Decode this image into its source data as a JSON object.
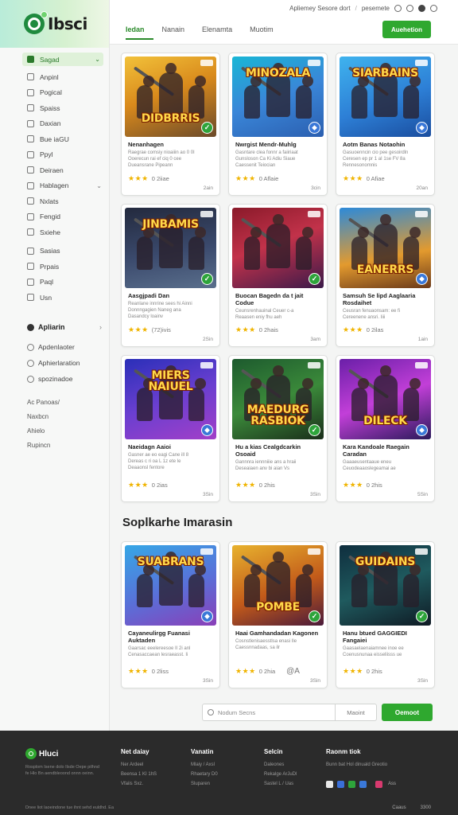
{
  "app": {
    "logo_text": "Ibsci"
  },
  "topbar": {
    "util_text": "Apliemey Sesore dort",
    "util_sep": "/",
    "util_link": "pesemete",
    "tabs": [
      "Iedan",
      "Nanain",
      "Elenamta",
      "Muotim"
    ],
    "cta": "Auehetion"
  },
  "sidebar": {
    "items": [
      {
        "label": "Sagad",
        "active": true
      },
      {
        "label": "Anpinl"
      },
      {
        "label": "Pogical"
      },
      {
        "label": "Spaiss"
      },
      {
        "label": "Daxian"
      },
      {
        "label": "Bue iaGU"
      },
      {
        "label": "Ppyl"
      },
      {
        "label": "Deiraen"
      },
      {
        "label": "Hablagen",
        "chevron": true
      },
      {
        "label": "Nxlats"
      },
      {
        "label": "Fengid"
      },
      {
        "label": "Sxiehe"
      },
      {
        "label": "Sasias"
      },
      {
        "label": "Prpais"
      },
      {
        "label": "Paql"
      },
      {
        "label": "Usn"
      }
    ],
    "section2_title": "Apliarin",
    "section2_items": [
      "Apdenlaoter",
      "Aphierlaration",
      "spozinadoe"
    ],
    "plain_items": [
      "Ac Panoas/",
      "Naxbcn",
      "Ahielo",
      "Rupincn"
    ]
  },
  "cards": [
    {
      "title": "Nenanhagen",
      "desc1": "Raegrae comsiy nioaiiin ao 0 0I",
      "desc2": "Ooerecun rai ef ciq 0 cee",
      "desc3": "Dueansrane Pipeann",
      "reviews": "0 2iiae",
      "size": "2ain",
      "thumb_text": "DIDBRRIS",
      "bg": "linear-gradient(160deg,#f2c23a 0%,#d98a1c 45%,#6b4a2a 100%)",
      "badge": "green",
      "badge_icon": "✓"
    },
    {
      "title": "Nwrgist Mendr-Muhlg",
      "desc1": "Gasntare clea fonnr a faiiriaat",
      "desc2": "Gunsloson Ca Ki Adiu Siaue",
      "desc3": "Caessenit Teiocian",
      "reviews": "0 Aflaie",
      "size": "3cin",
      "thumb_text": "MINOZALA",
      "thumb_top": true,
      "bg": "linear-gradient(160deg,#19b6d6 0%,#3a86d8 50%,#2b5fb0 100%)",
      "badge": "blue",
      "badge_icon": "⬥"
    },
    {
      "title": "Aotm Banas Notaohin",
      "desc1": "Gasuoenncin cio pee gesoirdln",
      "desc2": "Ceresen ep pr 1 aI 1se FV 8a",
      "desc3": "Rennesonomnis",
      "reviews": "0 Afiae",
      "size": "20an",
      "thumb_text": "SIARBAINS",
      "thumb_top": true,
      "bg": "linear-gradient(160deg,#3fb3ee 0%,#2d7fd6 55%,#1a4d9e 100%)",
      "badge": "blue",
      "badge_icon": "⬥"
    },
    {
      "title": "Aasgjpadi Dan",
      "desc1": "Reanlane innrine sees hi Ainni",
      "desc2": "Donnngagien Naneg ana",
      "desc3": "Dasandcy loainv",
      "reviews": "(72)ivis",
      "size": "2Sin",
      "thumb_text": "JINBAMIS",
      "thumb_top": true,
      "bg": "linear-gradient(170deg,#232a3e 0%,#3b4a6d 55%,#5a6f8c 100%)",
      "badge": "green",
      "badge_icon": "✓"
    },
    {
      "title": "Buocan Bagedn da t jait Codue",
      "desc1": "Ceunsrenhauinal Ceuer c-a",
      "desc2": "Reaasen eniy fhu aeh",
      "desc3": "",
      "reviews": "0 2hais",
      "size": "3am",
      "thumb_text": "",
      "bg": "linear-gradient(160deg,#8a1a2a 0%,#c2324a 45%,#3b1a4a 100%)",
      "badge": "green",
      "badge_icon": "✓"
    },
    {
      "title": "Samsuh Se lipd Aaglaaria Rosdaihet",
      "desc1": "Ceusran fenuaonsam: ee fi",
      "desc2": "Cereenene ansri. Iiii",
      "desc3": "",
      "reviews": "0 2ilas",
      "size": "1ain",
      "thumb_text": "EANERRS",
      "bg": "linear-gradient(170deg,#2d8ad9 0%,#e39a2e 60%,#6b3a1a 100%)",
      "badge": "blue",
      "badge_icon": "⬥"
    },
    {
      "title": "Naeidagn Aaioi",
      "desc1": "Gasner ae eo eagi Cane ill 8",
      "desc2": "Dereas c ri oa L 1z ete le",
      "desc3": "Deaaonsl fentore",
      "reviews": "0 2ias",
      "size": "3Sin",
      "thumb_text": "MIERS NAIUEL",
      "thumb_top": true,
      "bg": "linear-gradient(160deg,#2a2fb8 0%,#6a3fd0 50%,#a23fc8 100%)",
      "badge": "blue",
      "badge_icon": "⬥"
    },
    {
      "title": "Hu a kias Cealgdcarkin Osoaid",
      "desc1": "Gannnra iennniiie ans a hraii",
      "desc2": "Deseaiaen anv bi aian Vs",
      "desc3": "",
      "reviews": "0 2his",
      "size": "3Sin",
      "thumb_text": "MAEDURG RASBIOK",
      "bg": "linear-gradient(160deg,#1d5a2e 0%,#3b8a3a 50%,#1a2e1a 100%)",
      "badge": "green",
      "badge_icon": "✓"
    },
    {
      "title": "Kara Kandoale Raegain Caradan",
      "desc1": "Gaaaeusentaaue eneu",
      "desc2": "Ceuodeaaoslegeamai ae",
      "desc3": "",
      "reviews": "0 2his",
      "size": "5Sin",
      "thumb_text": "DILECK",
      "bg": "linear-gradient(160deg,#6a1fa8 0%,#c23fd8 50%,#2a1a5a 100%)",
      "badge": "blue",
      "badge_icon": "⬥"
    },
    {
      "title": "Cayaneulirgg Fuanasi Auktaden",
      "desc1": "Gaarsac eeelereesoe II 2i anl",
      "desc2": "Cenasaccaean lesraeasst. Ii",
      "desc3": "",
      "reviews": "0 2liss",
      "size": "3Sin",
      "thumb_text": "SUABRANS",
      "thumb_top": true,
      "bg": "linear-gradient(160deg,#36a7e6 0%,#5a6fd8 55%,#8a3fb8 100%)",
      "badge": "blue",
      "badge_icon": "⬥"
    },
    {
      "title": "Haai Gamhandadan Kagonen",
      "desc1": "Cosnstlenisaesstlsa enasi Ile",
      "desc2": "Caessnnadaas, sa ilr",
      "desc3": "",
      "reviews": "0 2hia",
      "size": "3Sin",
      "extra": "@A",
      "thumb_text": "POMBE",
      "bg": "linear-gradient(160deg,#e8b22e 0%,#c25a1a 55%,#4a1a3a 100%)",
      "badge": "green",
      "badge_icon": "✓"
    },
    {
      "title": "Hanu btued GAGGIEDI Fangaiei",
      "desc1": "Gaasaelaenaiamnee inoe ee",
      "desc2": "Coenusnunaa eisseliisss ue",
      "desc3": "",
      "reviews": "0 2his",
      "size": "3Sin",
      "thumb_text": "GUIDAINS",
      "thumb_top": true,
      "bg": "linear-gradient(160deg,#0f2e3e 0%,#1f5a5e 50%,#0f1a24 100%)",
      "badge": "green",
      "badge_icon": "✓"
    }
  ],
  "section_title": "Soplkarhe Imarasin",
  "search": {
    "placeholder": "Nodum Secns",
    "mid_label": "Maoint",
    "go": "Oemoot"
  },
  "footer": {
    "logo": "Hluci",
    "about": "Rosplom Isene dolo Ilsde Oepe pilhnd fe Hlo Bn aendbleoond onnn oeinn.",
    "cols": [
      {
        "title": "Net daiay",
        "links": [
          "Ner Ardeel",
          "Beensa 1 KI 1hS",
          "Vfaiis Sxz."
        ]
      },
      {
        "title": "Vanatin",
        "links": [
          "Mlaiy / Axsl",
          "Rhaetary D0",
          "Sluparen"
        ]
      },
      {
        "title": "Selcin",
        "links": [
          "Daleones",
          "Rekalge ArJuDl",
          "Sastel L / Uas"
        ]
      },
      {
        "title": "Raonm tiok",
        "links": [
          "Bunn bat Hol dinuald Greotio"
        ]
      }
    ],
    "icon_label": "Ass",
    "copyright": "Dnee liot laoeindone tue ihnt sehd euldhd.  Ea",
    "right_a": "Caaus",
    "right_b": "3300"
  },
  "colors": {
    "accent": "#2fa82f",
    "footer_bg": "#2b2b2b"
  }
}
